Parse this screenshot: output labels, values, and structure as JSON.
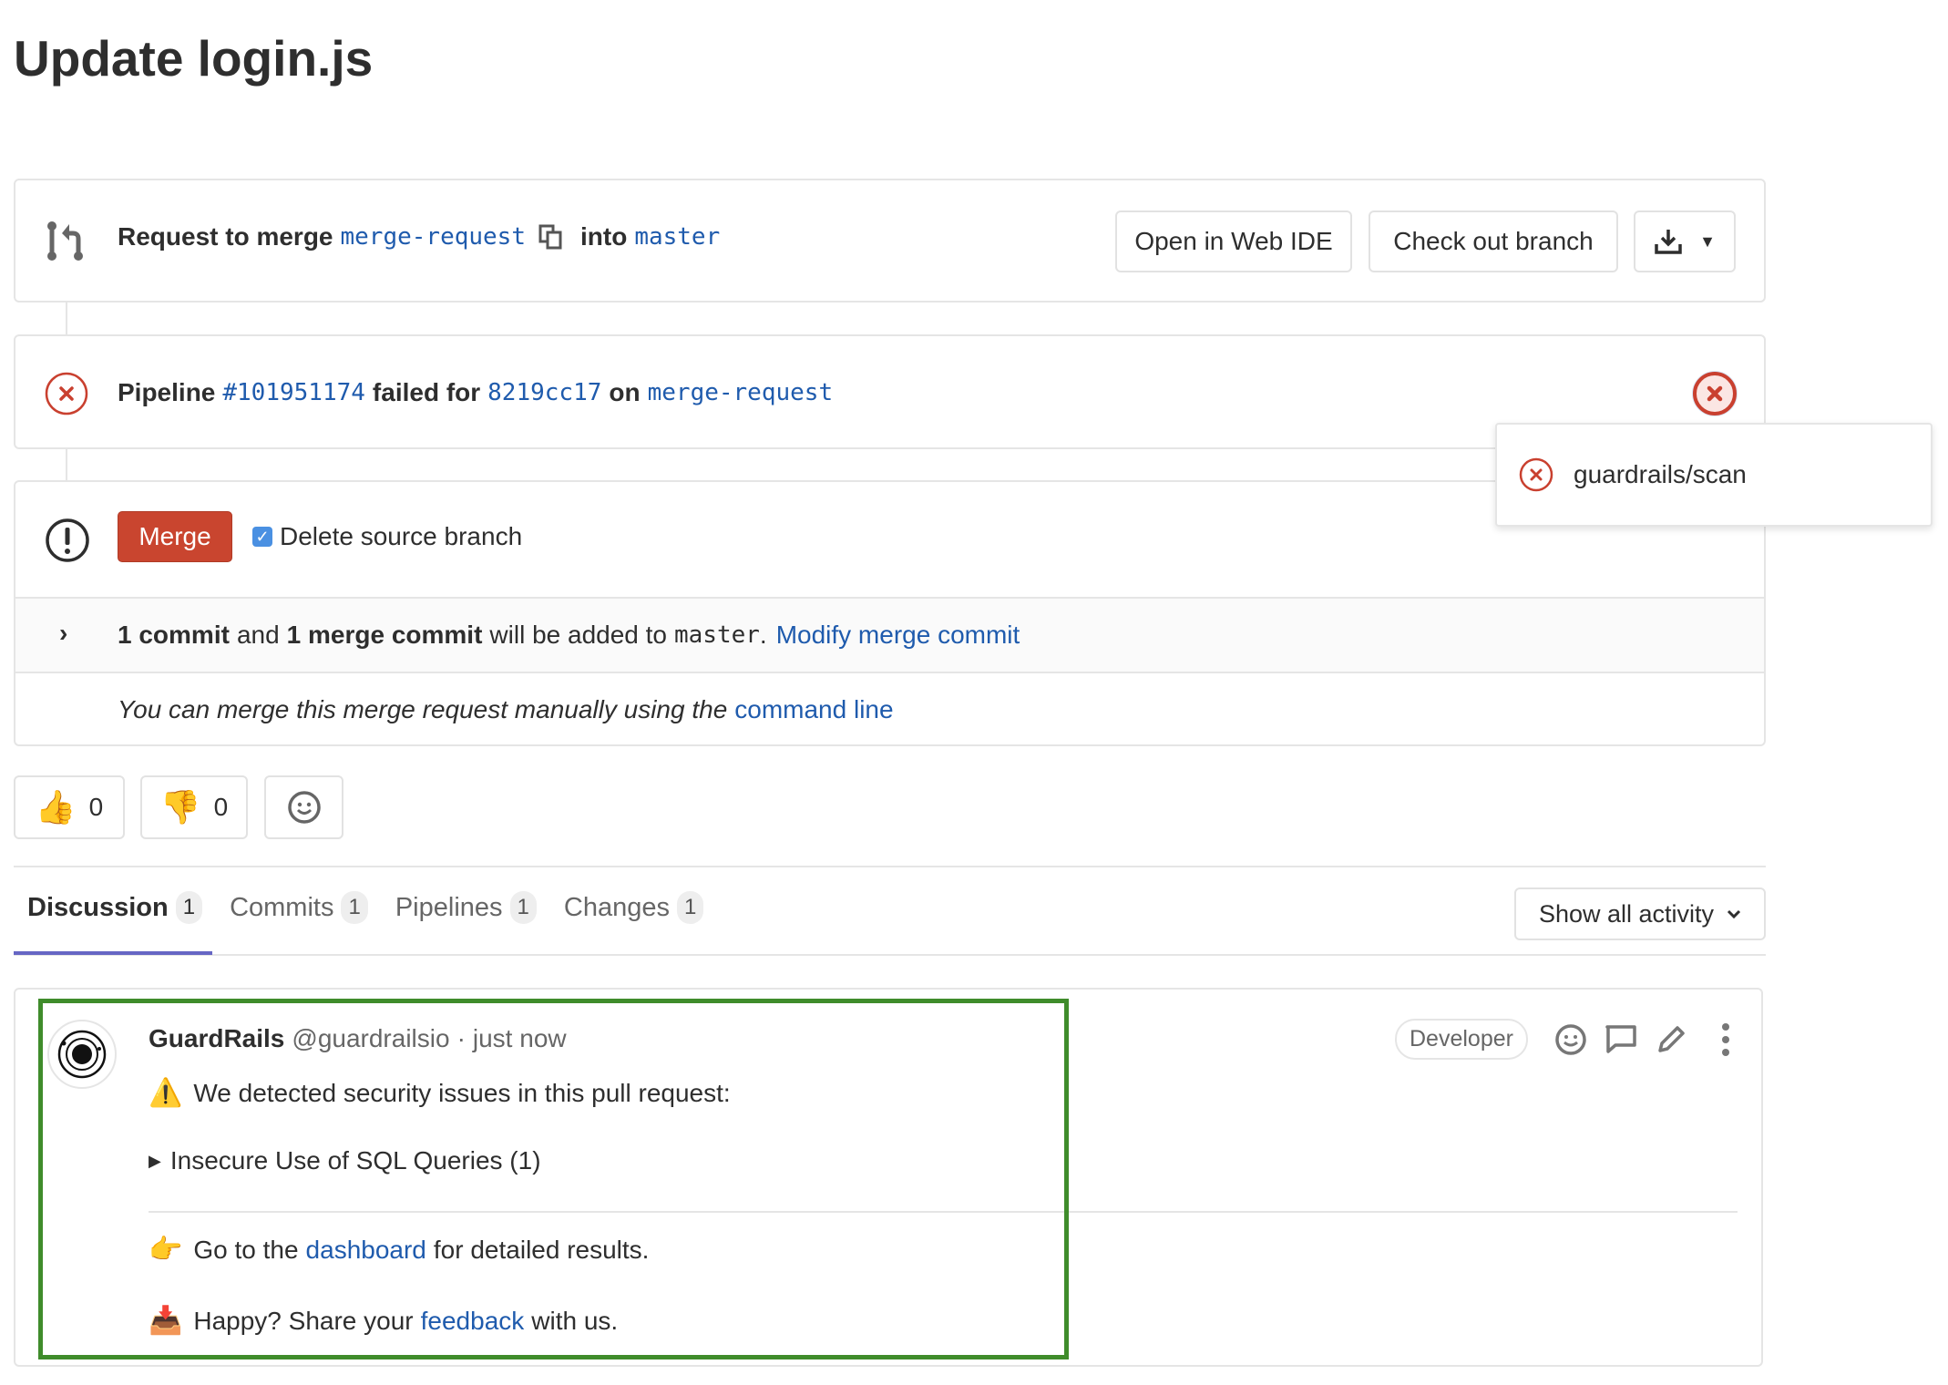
{
  "page": {
    "title": "Update login.js"
  },
  "merge_header": {
    "prefix": "Request to merge",
    "source_branch": "merge-request",
    "into_label": "into",
    "target_branch": "master",
    "open_web_ide_label": "Open in Web IDE",
    "checkout_branch_label": "Check out branch"
  },
  "pipeline": {
    "prefix": "Pipeline",
    "id": "#101951174",
    "failed_for": "failed for",
    "commit": "8219cc17",
    "on_label": "on",
    "branch": "merge-request",
    "status": "failed",
    "popup_job": "guardrails/scan"
  },
  "merge_section": {
    "merge_label": "Merge",
    "delete_source_label": "Delete source branch",
    "delete_source_checked": true,
    "commit_count": "1 commit",
    "and_label": "and",
    "merge_commit_count": "1 merge commit",
    "added_to": "will be added to",
    "target": "master",
    "period": ".",
    "modify_link": "Modify merge commit",
    "manual_text": "You can merge this merge request manually using the",
    "command_line_link": "command line"
  },
  "reactions": {
    "thumbsup_count": "0",
    "thumbsdown_count": "0"
  },
  "tabs": [
    {
      "label": "Discussion",
      "count": "1",
      "active": true
    },
    {
      "label": "Commits",
      "count": "1"
    },
    {
      "label": "Pipelines",
      "count": "1"
    },
    {
      "label": "Changes",
      "count": "1"
    }
  ],
  "activity_filter": {
    "label": "Show all activity"
  },
  "note": {
    "author": "GuardRails",
    "handle": "@guardrailsio",
    "separator": "·",
    "time": "just now",
    "role_badge": "Developer",
    "line1": "We detected security issues in this pull request:",
    "details_summary": "Insecure Use of SQL Queries (1)",
    "dashboard_prefix": "Go to the",
    "dashboard_link": "dashboard",
    "dashboard_suffix": "for detailed results.",
    "feedback_prefix": "Happy? Share your",
    "feedback_link": "feedback",
    "feedback_suffix": "with us.",
    "highlight_color": "#3f8c2b"
  },
  "colors": {
    "link": "#1f5bad",
    "danger": "#c9402f",
    "tab_active": "#6666c4"
  }
}
